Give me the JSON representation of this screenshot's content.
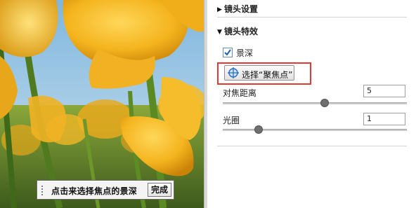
{
  "photo": {
    "hint_text": "点击来选择焦点的景深",
    "done_label": "完成"
  },
  "panel": {
    "lens_settings": {
      "label": "镜头设置",
      "expanded": false
    },
    "lens_effects": {
      "label": "镜头特效",
      "expanded": true
    },
    "depth_of_field": {
      "label": "景深",
      "checked": true
    },
    "pick_focus_button": {
      "label": "选择“聚焦点”",
      "icon": "crosshair-target-icon"
    },
    "focus_distance": {
      "label": "对焦距离",
      "value": "5",
      "slider_fraction": 0.55
    },
    "aperture": {
      "label": "光圈",
      "value": "1",
      "slider_fraction": 0.18
    }
  },
  "colors": {
    "highlight": "#e53935",
    "tulip": "#f2b21c",
    "accent": "#2d6fbf"
  }
}
